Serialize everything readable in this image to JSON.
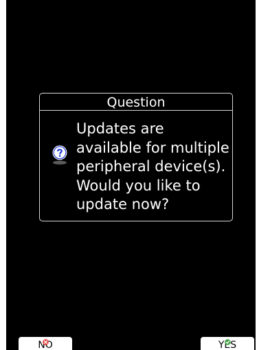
{
  "dialog": {
    "title": "Question",
    "icon": "question-icon",
    "message": "Updates are\navailable for multiple\nperipheral device(s).\nWould you like to\nupdate now?"
  },
  "softkeys": {
    "no": {
      "label": "NO",
      "icon": "red-x-icon"
    },
    "yes": {
      "label": "YES",
      "icon": "green-check-icon"
    }
  },
  "colors": {
    "screen_background": "#000000",
    "text": "#ffffff",
    "border": "#d8d8d8",
    "softkey_background": "#ffffff",
    "no_icon": "#e53935",
    "yes_icon": "#43a047",
    "question_icon": "#1f3bd3"
  }
}
